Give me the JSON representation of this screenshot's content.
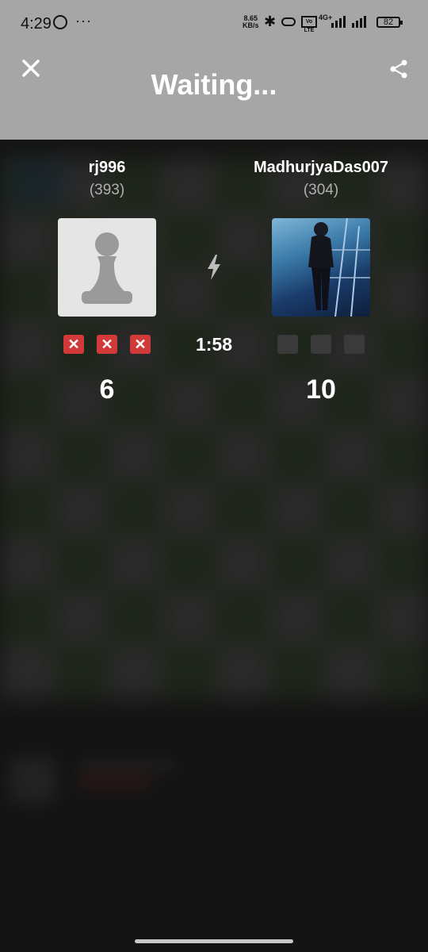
{
  "status_bar": {
    "time": "4:29",
    "dots": "···",
    "net_speed_value": "8.65",
    "net_speed_unit": "KB/s",
    "volte": "Vo LTE",
    "network": "4G+",
    "battery": "82"
  },
  "header": {
    "title": "Waiting..."
  },
  "players": [
    {
      "name": "rj996",
      "rating": "(393)",
      "results": [
        "x",
        "x",
        "x"
      ],
      "score": "6"
    },
    {
      "name": "MadhurjyaDas007",
      "rating": "(304)",
      "results": [
        "empty",
        "empty",
        "empty"
      ],
      "score": "10"
    }
  ],
  "timer": "1:58",
  "colors": {
    "header_bg": "#a6a6a6",
    "loss_mark": "#d23a3a",
    "empty_mark": "#3a3a3a"
  }
}
